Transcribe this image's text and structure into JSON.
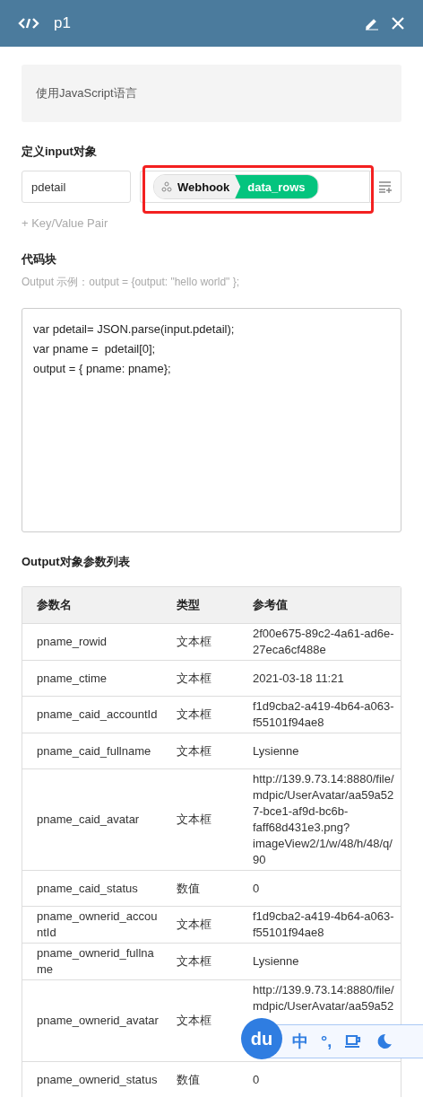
{
  "header": {
    "title": "p1"
  },
  "language_note": "使用JavaScript语言",
  "input_section": {
    "label": "定义input对象",
    "key": "pdetail",
    "source": {
      "node": "Webhook",
      "field": "data_rows"
    },
    "add_pair": "+ Key/Value Pair"
  },
  "code_section": {
    "label": "代码块",
    "hint": "Output 示例：output = {output: \"hello world\" };",
    "code": [
      "var pdetail= JSON.parse(input.pdetail);",
      "var pname =  pdetail[0];",
      "output = { pname: pname};"
    ]
  },
  "output_section": {
    "label": "Output对象参数列表",
    "columns": [
      "参数名",
      "类型",
      "参考值"
    ],
    "rows": [
      {
        "name": "pname_rowid",
        "type": "文本框",
        "value": "2f00e675-89c2-4a61-ad6e-27eca6cf488e"
      },
      {
        "name": "pname_ctime",
        "type": "文本框",
        "value": "2021-03-18 11:21"
      },
      {
        "name": "pname_caid_accountId",
        "type": "文本框",
        "value": "f1d9cba2-a419-4b64-a063-f55101f94ae8"
      },
      {
        "name": "pname_caid_fullname",
        "type": "文本框",
        "value": "Lysienne"
      },
      {
        "name": "pname_caid_avatar",
        "type": "文本框",
        "value": "http://139.9.73.14:8880/file/mdpic/UserAvatar/aa59a527-bce1-af9d-bc6b-faff68d431e3.png?imageView2/1/w/48/h/48/q/90"
      },
      {
        "name": "pname_caid_status",
        "type": "数值",
        "value": "0"
      },
      {
        "name": "pname_ownerid_accountId",
        "type": "文本框",
        "value": "f1d9cba2-a419-4b64-a063-f55101f94ae8"
      },
      {
        "name": "pname_ownerid_fullname",
        "type": "文本框",
        "value": "Lysienne"
      },
      {
        "name": "pname_ownerid_avatar",
        "type": "文本框",
        "value": "http://139.9.73.14:8880/file/mdpic/UserAvatar/aa59a52",
        "ime_toolbar": {
          "logo": "du",
          "items": [
            {
              "kind": "text",
              "text": "中"
            },
            {
              "kind": "text",
              "text": "°,"
            },
            {
              "kind": "cup"
            },
            {
              "kind": "moon"
            }
          ]
        }
      },
      {
        "name": "pname_ownerid_status",
        "type": "数值",
        "value": "0"
      }
    ]
  }
}
